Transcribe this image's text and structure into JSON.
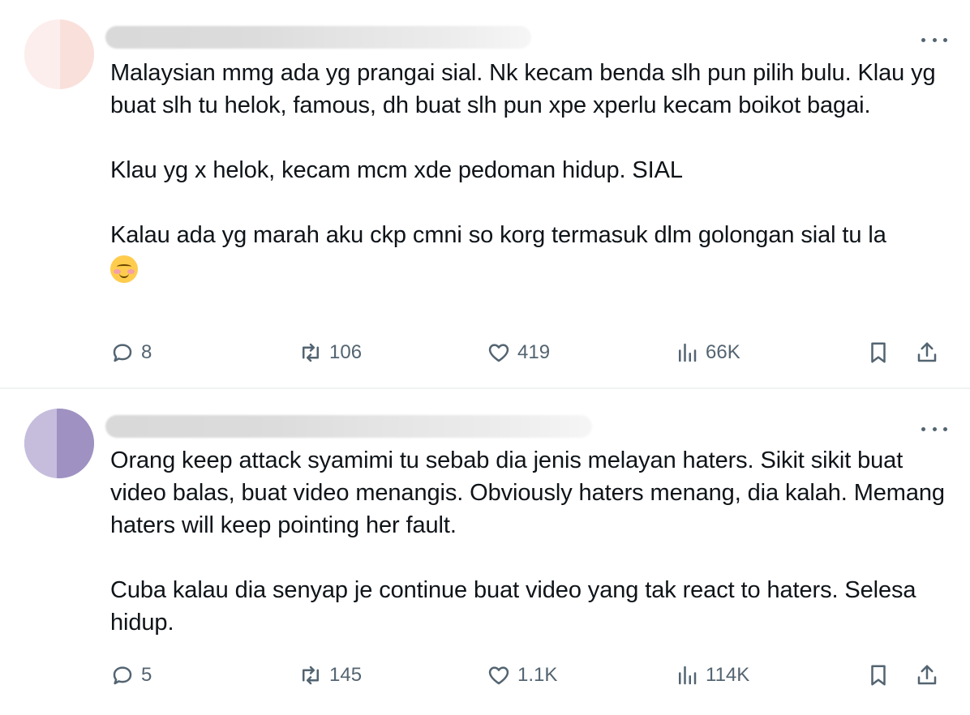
{
  "tweets": [
    {
      "text": "Malaysian mmg ada yg prangai sial. Nk kecam benda slh pun pilih bulu. Klau yg buat slh tu helok, famous, dh buat slh pun xpe xperlu kecam boikot bagai.\n\nKlau yg x helok, kecam mcm xde pedoman hidup. SIAL\n\nKalau ada yg marah aku ckp cmni so korg termasuk dlm golongan sial tu la",
      "emoji": "smiling-face-with-blush",
      "replies": "8",
      "reposts": "106",
      "likes": "419",
      "views": "66K"
    },
    {
      "text": "Orang keep attack syamimi tu sebab dia jenis melayan haters. Sikit sikit buat video balas, buat video menangis. Obviously haters menang, dia kalah. Memang haters will keep pointing her fault.\n\nCuba kalau dia senyap je continue buat video yang tak react to haters. Selesa hidup.",
      "replies": "5",
      "reposts": "145",
      "likes": "1.1K",
      "views": "114K"
    }
  ],
  "icons": {
    "reply": "reply-icon",
    "repost": "repost-icon",
    "like": "heart-icon",
    "views": "views-icon",
    "bookmark": "bookmark-icon",
    "share": "share-icon",
    "more": "more-icon"
  },
  "colors": {
    "text": "#0f1419",
    "muted": "#536471",
    "divider": "#eff3f4"
  }
}
